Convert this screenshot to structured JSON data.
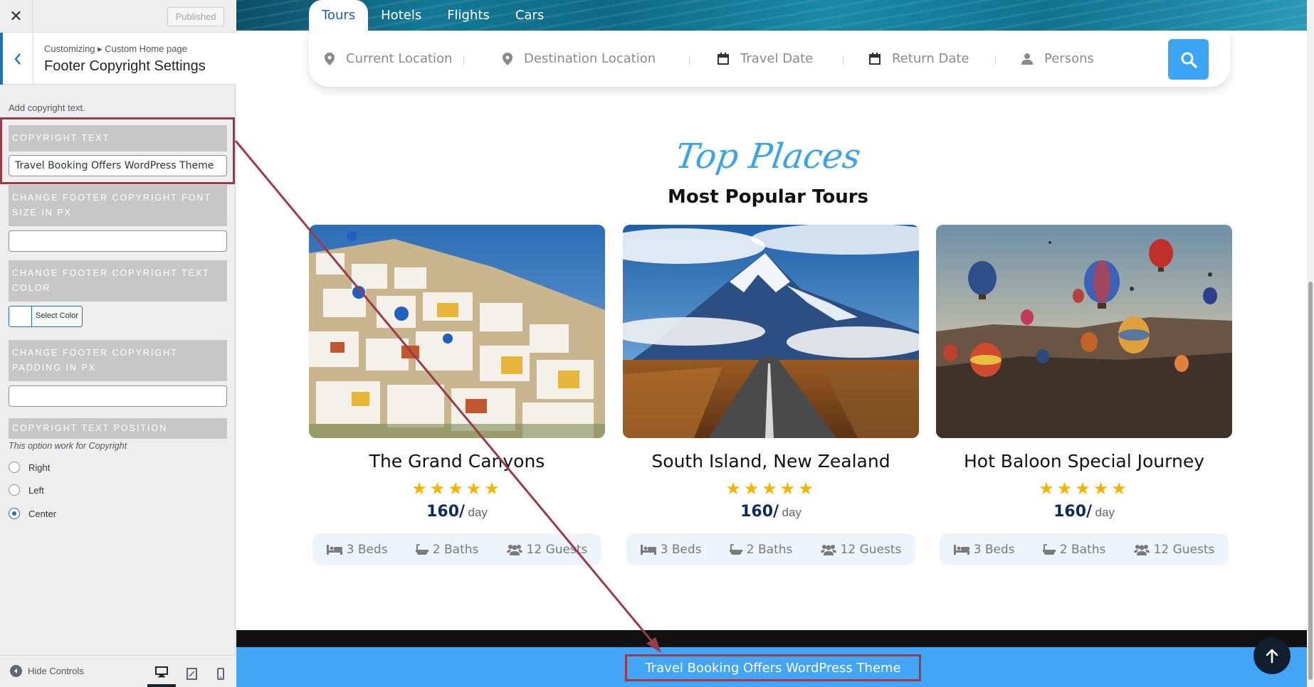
{
  "customizer": {
    "close_icon": "close-icon",
    "published_label": "Published",
    "breadcrumb": "Customizing ▸ Custom Home page",
    "section_title": "Footer Copyright Settings",
    "description": "Add copyright text.",
    "controls": {
      "copyright_text_label": "Copyright Text",
      "copyright_text_value": "Travel Booking Offers WordPress Theme",
      "font_size_label": "Change Footer Copyright Font Size in PX",
      "font_size_value": "",
      "text_color_label": "Change Footer Copyright Text Color",
      "select_color_label": "Select Color",
      "padding_label": "Change Footer Copyright Padding in PX",
      "padding_value": "",
      "position_label": "Copyright Text Position",
      "position_note": "This option work for Copyright",
      "position_options": [
        "Right",
        "Left",
        "Center"
      ],
      "position_selected": "Center"
    },
    "footer": {
      "hide_controls_label": "Hide Controls"
    }
  },
  "preview": {
    "tabs": [
      "Tours",
      "Hotels",
      "Flights",
      "Cars"
    ],
    "active_tab": "Tours",
    "search": {
      "current_location": "Current Location",
      "destination_location": "Destination Location",
      "travel_date": "Travel Date",
      "return_date": "Return Date",
      "persons": "Persons"
    },
    "section_script_title": "Top Places",
    "section_title": "Most Popular Tours",
    "tours": [
      {
        "name": "The Grand Canyons",
        "rating": 5,
        "price": "160/",
        "unit": "day",
        "beds": "3 Beds",
        "baths": "2 Baths",
        "guests": "12 Guests"
      },
      {
        "name": "South Island, New Zealand",
        "rating": 5,
        "price": "160/",
        "unit": "day",
        "beds": "3 Beds",
        "baths": "2 Baths",
        "guests": "12 Guests"
      },
      {
        "name": "Hot Baloon Special Journey",
        "rating": 5,
        "price": "160/",
        "unit": "day",
        "beds": "3 Beds",
        "baths": "2 Baths",
        "guests": "12 Guests"
      }
    ],
    "footer_copyright": "Travel Booking Offers WordPress Theme"
  },
  "colors": {
    "accent_blue": "#42a5f5",
    "admin_blue": "#2271b1",
    "highlight_red": "#9c3a49",
    "star_yellow": "#f5b301"
  }
}
